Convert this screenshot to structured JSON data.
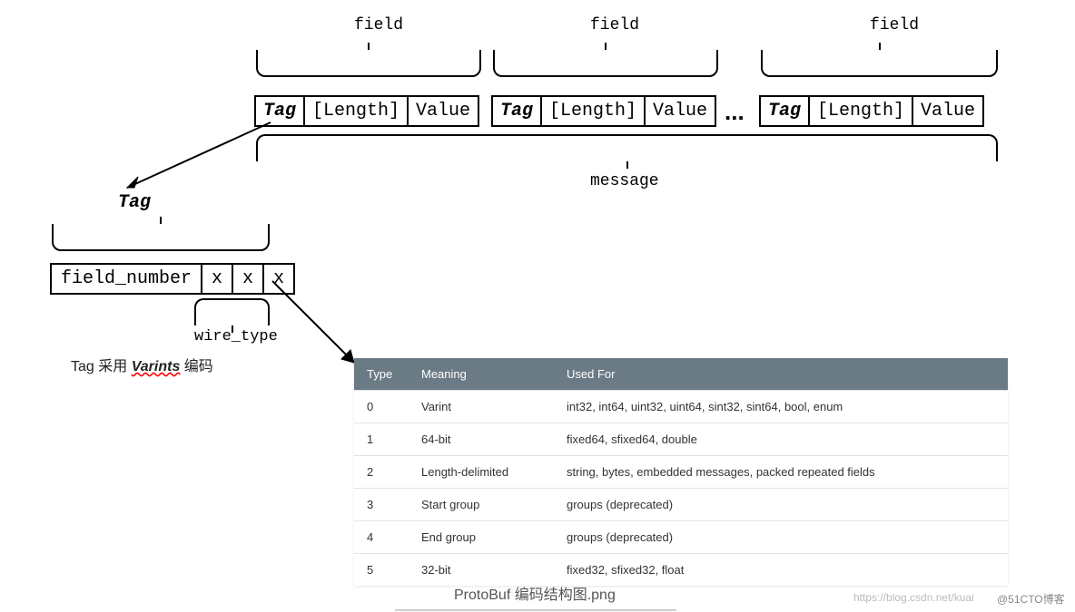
{
  "labels": {
    "field": "field",
    "tag": "Tag",
    "length": "[Length]",
    "value": "Value",
    "ellipsis": "...",
    "message": "message",
    "field_number": "field_number",
    "x": "x",
    "wire_type": "wire_type"
  },
  "note": {
    "prefix": "Tag 采用 ",
    "varints": "Varints",
    "suffix": " 编码"
  },
  "table": {
    "headers": [
      "Type",
      "Meaning",
      "Used For"
    ],
    "rows": [
      {
        "type": "0",
        "meaning": "Varint",
        "used": "int32, int64, uint32, uint64, sint32, sint64, bool, enum"
      },
      {
        "type": "1",
        "meaning": "64-bit",
        "used": "fixed64, sfixed64, double"
      },
      {
        "type": "2",
        "meaning": "Length-delimited",
        "used": "string, bytes, embedded messages, packed repeated fields"
      },
      {
        "type": "3",
        "meaning": "Start group",
        "used": "groups (deprecated)"
      },
      {
        "type": "4",
        "meaning": "End group",
        "used": "groups (deprecated)"
      },
      {
        "type": "5",
        "meaning": "32-bit",
        "used": "fixed32, sfixed32, float"
      }
    ]
  },
  "caption": "ProtoBuf 编码结构图.png",
  "watermark_left": "https://blog.csdn.net/kuai",
  "watermark_right": "@51CTO博客",
  "chart_data": {
    "type": "table",
    "title": "ProtoBuf wire types",
    "columns": [
      "Type",
      "Meaning",
      "Used For"
    ],
    "rows": [
      [
        0,
        "Varint",
        "int32, int64, uint32, uint64, sint32, sint64, bool, enum"
      ],
      [
        1,
        "64-bit",
        "fixed64, sfixed64, double"
      ],
      [
        2,
        "Length-delimited",
        "string, bytes, embedded messages, packed repeated fields"
      ],
      [
        3,
        "Start group",
        "groups (deprecated)"
      ],
      [
        4,
        "End group",
        "groups (deprecated)"
      ],
      [
        5,
        "32-bit",
        "fixed32, sfixed32, float"
      ]
    ]
  }
}
